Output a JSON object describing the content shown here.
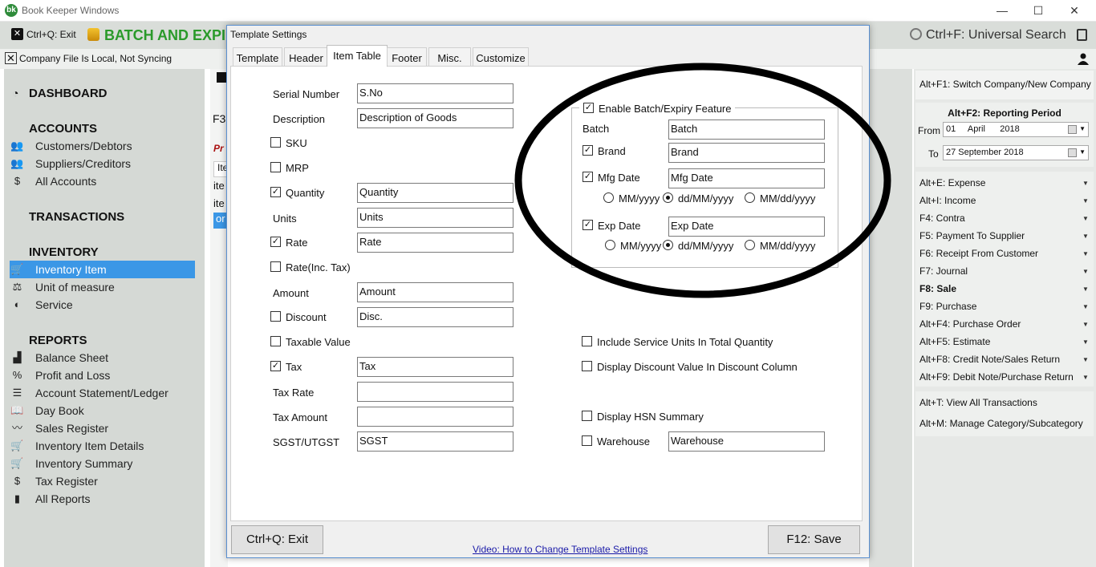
{
  "window": {
    "title": "Book Keeper Windows",
    "logo": "bk",
    "minimize": "—",
    "maximize": "☐",
    "close": "✕"
  },
  "toolbar": {
    "exit_label": "Ctrl+Q: Exit",
    "page_heading": "BATCH AND EXPI",
    "search_label": "Ctrl+F: Universal Search"
  },
  "status": {
    "sync_text": "Company File Is Local, Not Syncing"
  },
  "sidebar": {
    "dashboard": "DASHBOARD",
    "accounts_header": "ACCOUNTS",
    "accounts": [
      {
        "label": "Customers/Debtors",
        "icon": "customers-icon",
        "glyph": "👥"
      },
      {
        "label": "Suppliers/Creditors",
        "icon": "suppliers-icon",
        "glyph": "👥"
      },
      {
        "label": "All Accounts",
        "icon": "dollar-icon",
        "glyph": "$"
      }
    ],
    "transactions_header": "TRANSACTIONS",
    "inventory_header": "INVENTORY",
    "inventory": [
      {
        "label": "Inventory Item",
        "icon": "cart-icon",
        "glyph": "🛒",
        "active": true
      },
      {
        "label": "Unit of measure",
        "icon": "scale-icon",
        "glyph": "⚖"
      },
      {
        "label": "Service",
        "icon": "service-icon",
        "glyph": "◐"
      }
    ],
    "reports_header": "REPORTS",
    "reports": [
      {
        "label": "Balance Sheet",
        "icon": "factory-icon",
        "glyph": "▟"
      },
      {
        "label": "Profit and Loss",
        "icon": "percent-icon",
        "glyph": "%"
      },
      {
        "label": "Account Statement/Ledger",
        "icon": "ledger-icon",
        "glyph": "☰"
      },
      {
        "label": "Day Book",
        "icon": "book-icon",
        "glyph": "📖"
      },
      {
        "label": "Sales Register",
        "icon": "sales-icon",
        "glyph": "〰"
      },
      {
        "label": "Inventory Item Details",
        "icon": "cart-icon",
        "glyph": "🛒"
      },
      {
        "label": "Inventory Summary",
        "icon": "cart-icon",
        "glyph": "🛒"
      },
      {
        "label": "Tax Register",
        "icon": "moneybag-icon",
        "glyph": "$"
      },
      {
        "label": "All Reports",
        "icon": "bar-chart-icon",
        "glyph": "▮"
      }
    ]
  },
  "background": {
    "f3": "F3",
    "red_text": "Pr",
    "rows": [
      "Ite",
      "ite",
      "ite",
      "or"
    ]
  },
  "right_panel": {
    "switch_company": "Alt+F1: Switch Company/New Company",
    "period_title": "Alt+F2: Reporting Period",
    "from_label": "From",
    "from_value": "01     April      2018",
    "to_label": "To",
    "to_value": "27 September 2018",
    "actions": [
      {
        "label": "Alt+E: Expense",
        "bold": false
      },
      {
        "label": "Alt+I: Income",
        "bold": false
      },
      {
        "label": "F4: Contra",
        "bold": false
      },
      {
        "label": "F5: Payment To Supplier",
        "bold": false
      },
      {
        "label": "F6: Receipt From Customer",
        "bold": false
      },
      {
        "label": "F7: Journal",
        "bold": false
      },
      {
        "label": "F8: Sale",
        "bold": true
      },
      {
        "label": "F9: Purchase",
        "bold": false
      },
      {
        "label": "Alt+F4: Purchase Order",
        "bold": false
      },
      {
        "label": "Alt+F5: Estimate",
        "bold": false
      },
      {
        "label": "Alt+F8: Credit Note/Sales Return",
        "bold": false
      },
      {
        "label": "Alt+F9: Debit Note/Purchase Return",
        "bold": false
      }
    ],
    "view_all": "Alt+T: View All Transactions",
    "manage_category": "Alt+M: Manage Category/Subcategory"
  },
  "dialog": {
    "title": "Template Settings",
    "tabs": [
      "Template",
      "Header",
      "Item Table",
      "Footer",
      "Misc.",
      "Customize"
    ],
    "selected_tab": "Item Table",
    "fields": {
      "serial_number": {
        "label": "Serial Number",
        "value": "S.No"
      },
      "description": {
        "label": "Description",
        "value": "Description of Goods"
      },
      "sku": {
        "label": "SKU",
        "checked": false
      },
      "mrp": {
        "label": "MRP",
        "checked": false
      },
      "quantity": {
        "label": "Quantity",
        "checked": true,
        "value": "Quantity"
      },
      "units": {
        "label": "Units",
        "value": "Units"
      },
      "rate": {
        "label": "Rate",
        "checked": true,
        "value": "Rate"
      },
      "rate_inc_tax": {
        "label": "Rate(Inc. Tax)",
        "checked": false
      },
      "amount": {
        "label": "Amount",
        "value": "Amount"
      },
      "discount": {
        "label": "Discount",
        "checked": false,
        "value": "Disc."
      },
      "taxable_value": {
        "label": "Taxable Value",
        "checked": false
      },
      "tax": {
        "label": "Tax",
        "checked": true,
        "value": "Tax"
      },
      "tax_rate": {
        "label": "Tax Rate",
        "value": ""
      },
      "tax_amount": {
        "label": "Tax Amount",
        "value": ""
      },
      "sgst": {
        "label": "SGST/UTGST",
        "value": "SGST"
      }
    },
    "batch": {
      "enable_label": "Enable Batch/Expiry Feature",
      "enabled": true,
      "batch_label": "Batch",
      "batch_value": "Batch",
      "brand_label": "Brand",
      "brand_checked": true,
      "brand_value": "Brand",
      "mfg_label": "Mfg Date",
      "mfg_checked": true,
      "mfg_value": "Mfg Date",
      "exp_label": "Exp Date",
      "exp_checked": true,
      "exp_value": "Exp Date",
      "date_formats": [
        "MM/yyyy",
        "dd/MM/yyyy",
        "MM/dd/yyyy"
      ],
      "mfg_selected_format": "dd/MM/yyyy",
      "exp_selected_format": "dd/MM/yyyy"
    },
    "options": {
      "include_service_units": {
        "label": "Include Service Units In Total Quantity",
        "checked": false
      },
      "display_discount": {
        "label": "Display Discount Value In Discount Column",
        "checked": false
      },
      "display_hsn": {
        "label": "Display HSN Summary",
        "checked": false
      },
      "warehouse": {
        "label": "Warehouse",
        "checked": false,
        "value": "Warehouse"
      }
    },
    "exit_button": "Ctrl+Q: Exit",
    "save_button": "F12: Save",
    "video_link": "Video: How to Change Template Settings"
  },
  "colors": {
    "accent": "#3b97e6",
    "heading_green": "#2a9a2a",
    "annotation": "#000000"
  }
}
